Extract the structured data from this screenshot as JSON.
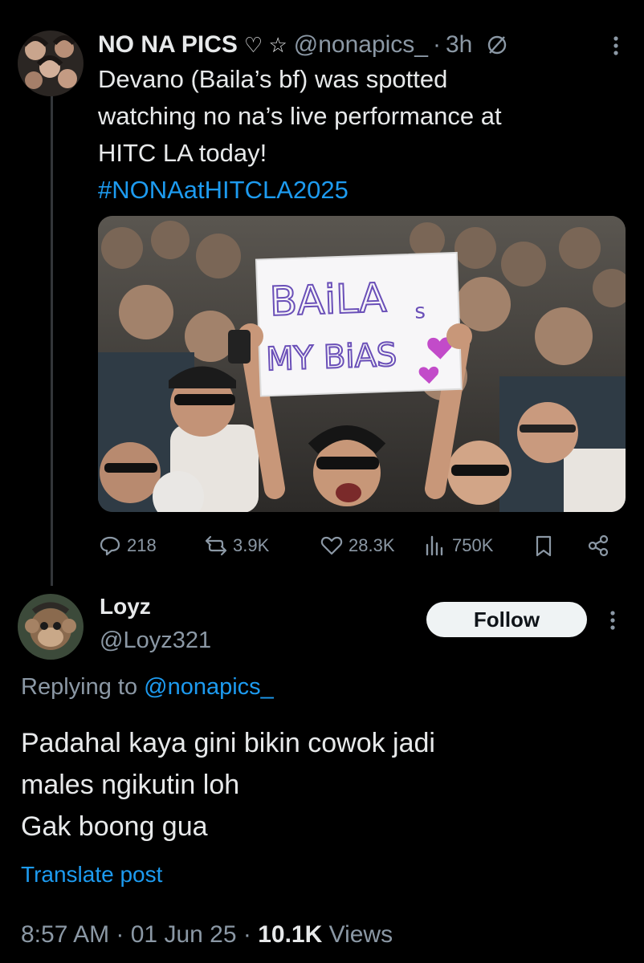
{
  "quoted_post": {
    "author_name": "NO NA PICS",
    "badges": "♡ ☆",
    "handle": "@nonapics_",
    "time": "3h",
    "text_lines": [
      "Devano (Baila’s bf) was spotted",
      "watching no na’s live performance at",
      "HITC LA today!"
    ],
    "hashtag": "#NONAatHITCLA2025",
    "sign_line1": "BAiLA",
    "sign_s": "s",
    "sign_line2": "MY BiAS",
    "stats": {
      "replies": "218",
      "reposts": "3.9K",
      "likes": "28.3K",
      "views": "750K"
    }
  },
  "reply": {
    "name": "Loyz",
    "handle": "@Loyz321",
    "follow_label": "Follow",
    "replying_prefix": "Replying to ",
    "replying_mention": "@nonapics_",
    "body_lines": [
      "Padahal kaya gini bikin cowok jadi",
      "males ngikutin loh",
      "Gak boong gua"
    ],
    "translate_label": "Translate post",
    "time": "8:57 AM",
    "date": "01 Jun 25",
    "views_count": "10.1K",
    "views_label": "Views"
  },
  "colors": {
    "background": "#000000",
    "text": "#e7e9ea",
    "secondary": "#8b98a5",
    "link": "#1d9bf0",
    "follow_bg": "#eff3f4"
  }
}
